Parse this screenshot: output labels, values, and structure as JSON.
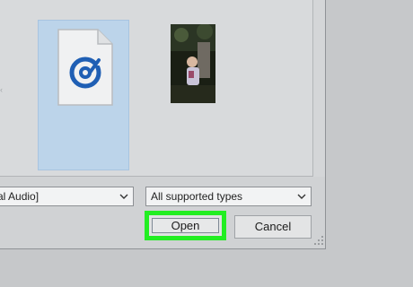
{
  "dialog": {
    "files": [
      {
        "kind": "audio-file",
        "icon": "groove-music-icon",
        "selected": true
      },
      {
        "kind": "video-file",
        "icon": "video-thumbnail",
        "selected": false
      }
    ]
  },
  "footer": {
    "filter_left_label": "al Audio]",
    "file_type_label": "All supported types",
    "open_label": "Open",
    "cancel_label": "Cancel"
  },
  "colors": {
    "selection": "#bcd4ea",
    "highlight_box": "#22ee22",
    "icon_blue": "#1f5fb4"
  }
}
